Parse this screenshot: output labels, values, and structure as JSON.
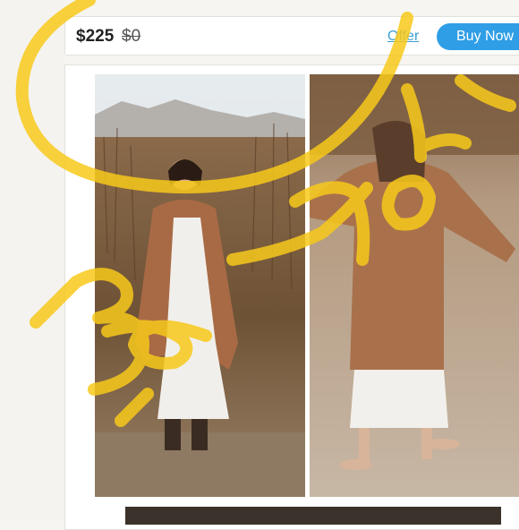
{
  "listing": {
    "price_current": "$225",
    "price_original": "$0",
    "offer_label": "Offer",
    "buy_label": "Buy Now"
  },
  "colors": {
    "buy_button": "#2f9ee6",
    "offer_link": "#3a9fd8",
    "highlighter": "#f7c91b"
  },
  "photos": [
    "woman-cardigan-standing-photo",
    "woman-cardigan-walking-photo",
    "portrait-photo-partial"
  ],
  "annotation": "handwritten-yellow-scribble"
}
